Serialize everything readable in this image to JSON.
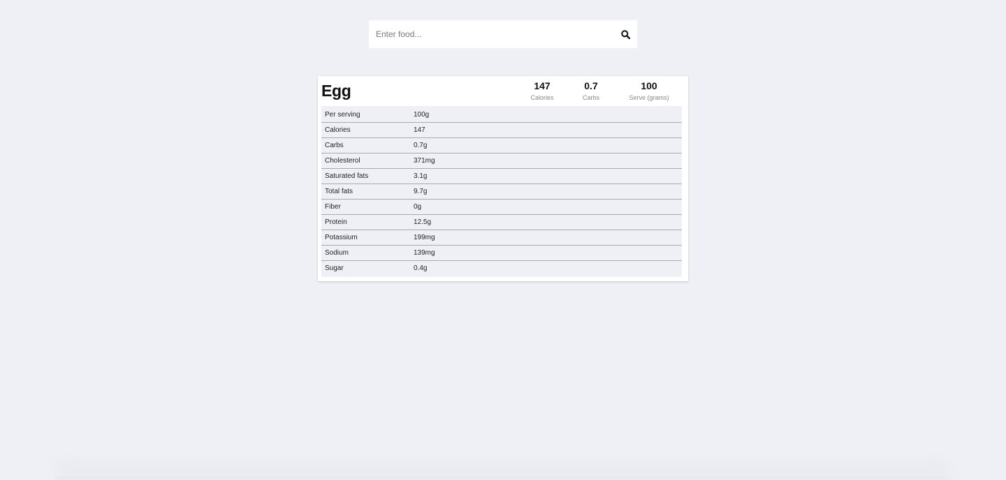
{
  "search": {
    "placeholder": "Enter food...",
    "value": ""
  },
  "food": {
    "name": "Egg",
    "summary": [
      {
        "value": "147",
        "label": "Calories"
      },
      {
        "value": "0.7",
        "label": "Carbs"
      },
      {
        "value": "100",
        "label": "Serve (grams)"
      }
    ],
    "nutrients": [
      {
        "name": "Per serving",
        "amount": "100g"
      },
      {
        "name": "Calories",
        "amount": "147"
      },
      {
        "name": "Carbs",
        "amount": "0.7g"
      },
      {
        "name": "Cholesterol",
        "amount": "371mg"
      },
      {
        "name": "Saturated fats",
        "amount": "3.1g"
      },
      {
        "name": "Total fats",
        "amount": "9.7g"
      },
      {
        "name": "Fiber",
        "amount": "0g"
      },
      {
        "name": "Protein",
        "amount": "12.5g"
      },
      {
        "name": "Potassium",
        "amount": "199mg"
      },
      {
        "name": "Sodium",
        "amount": "139mg"
      },
      {
        "name": "Sugar",
        "amount": "0.4g"
      }
    ]
  },
  "icons": {
    "search": "search-icon"
  },
  "colors": {
    "background": "#eff0f5",
    "card": "#ffffff",
    "text": "#111111",
    "muted": "#888888"
  }
}
